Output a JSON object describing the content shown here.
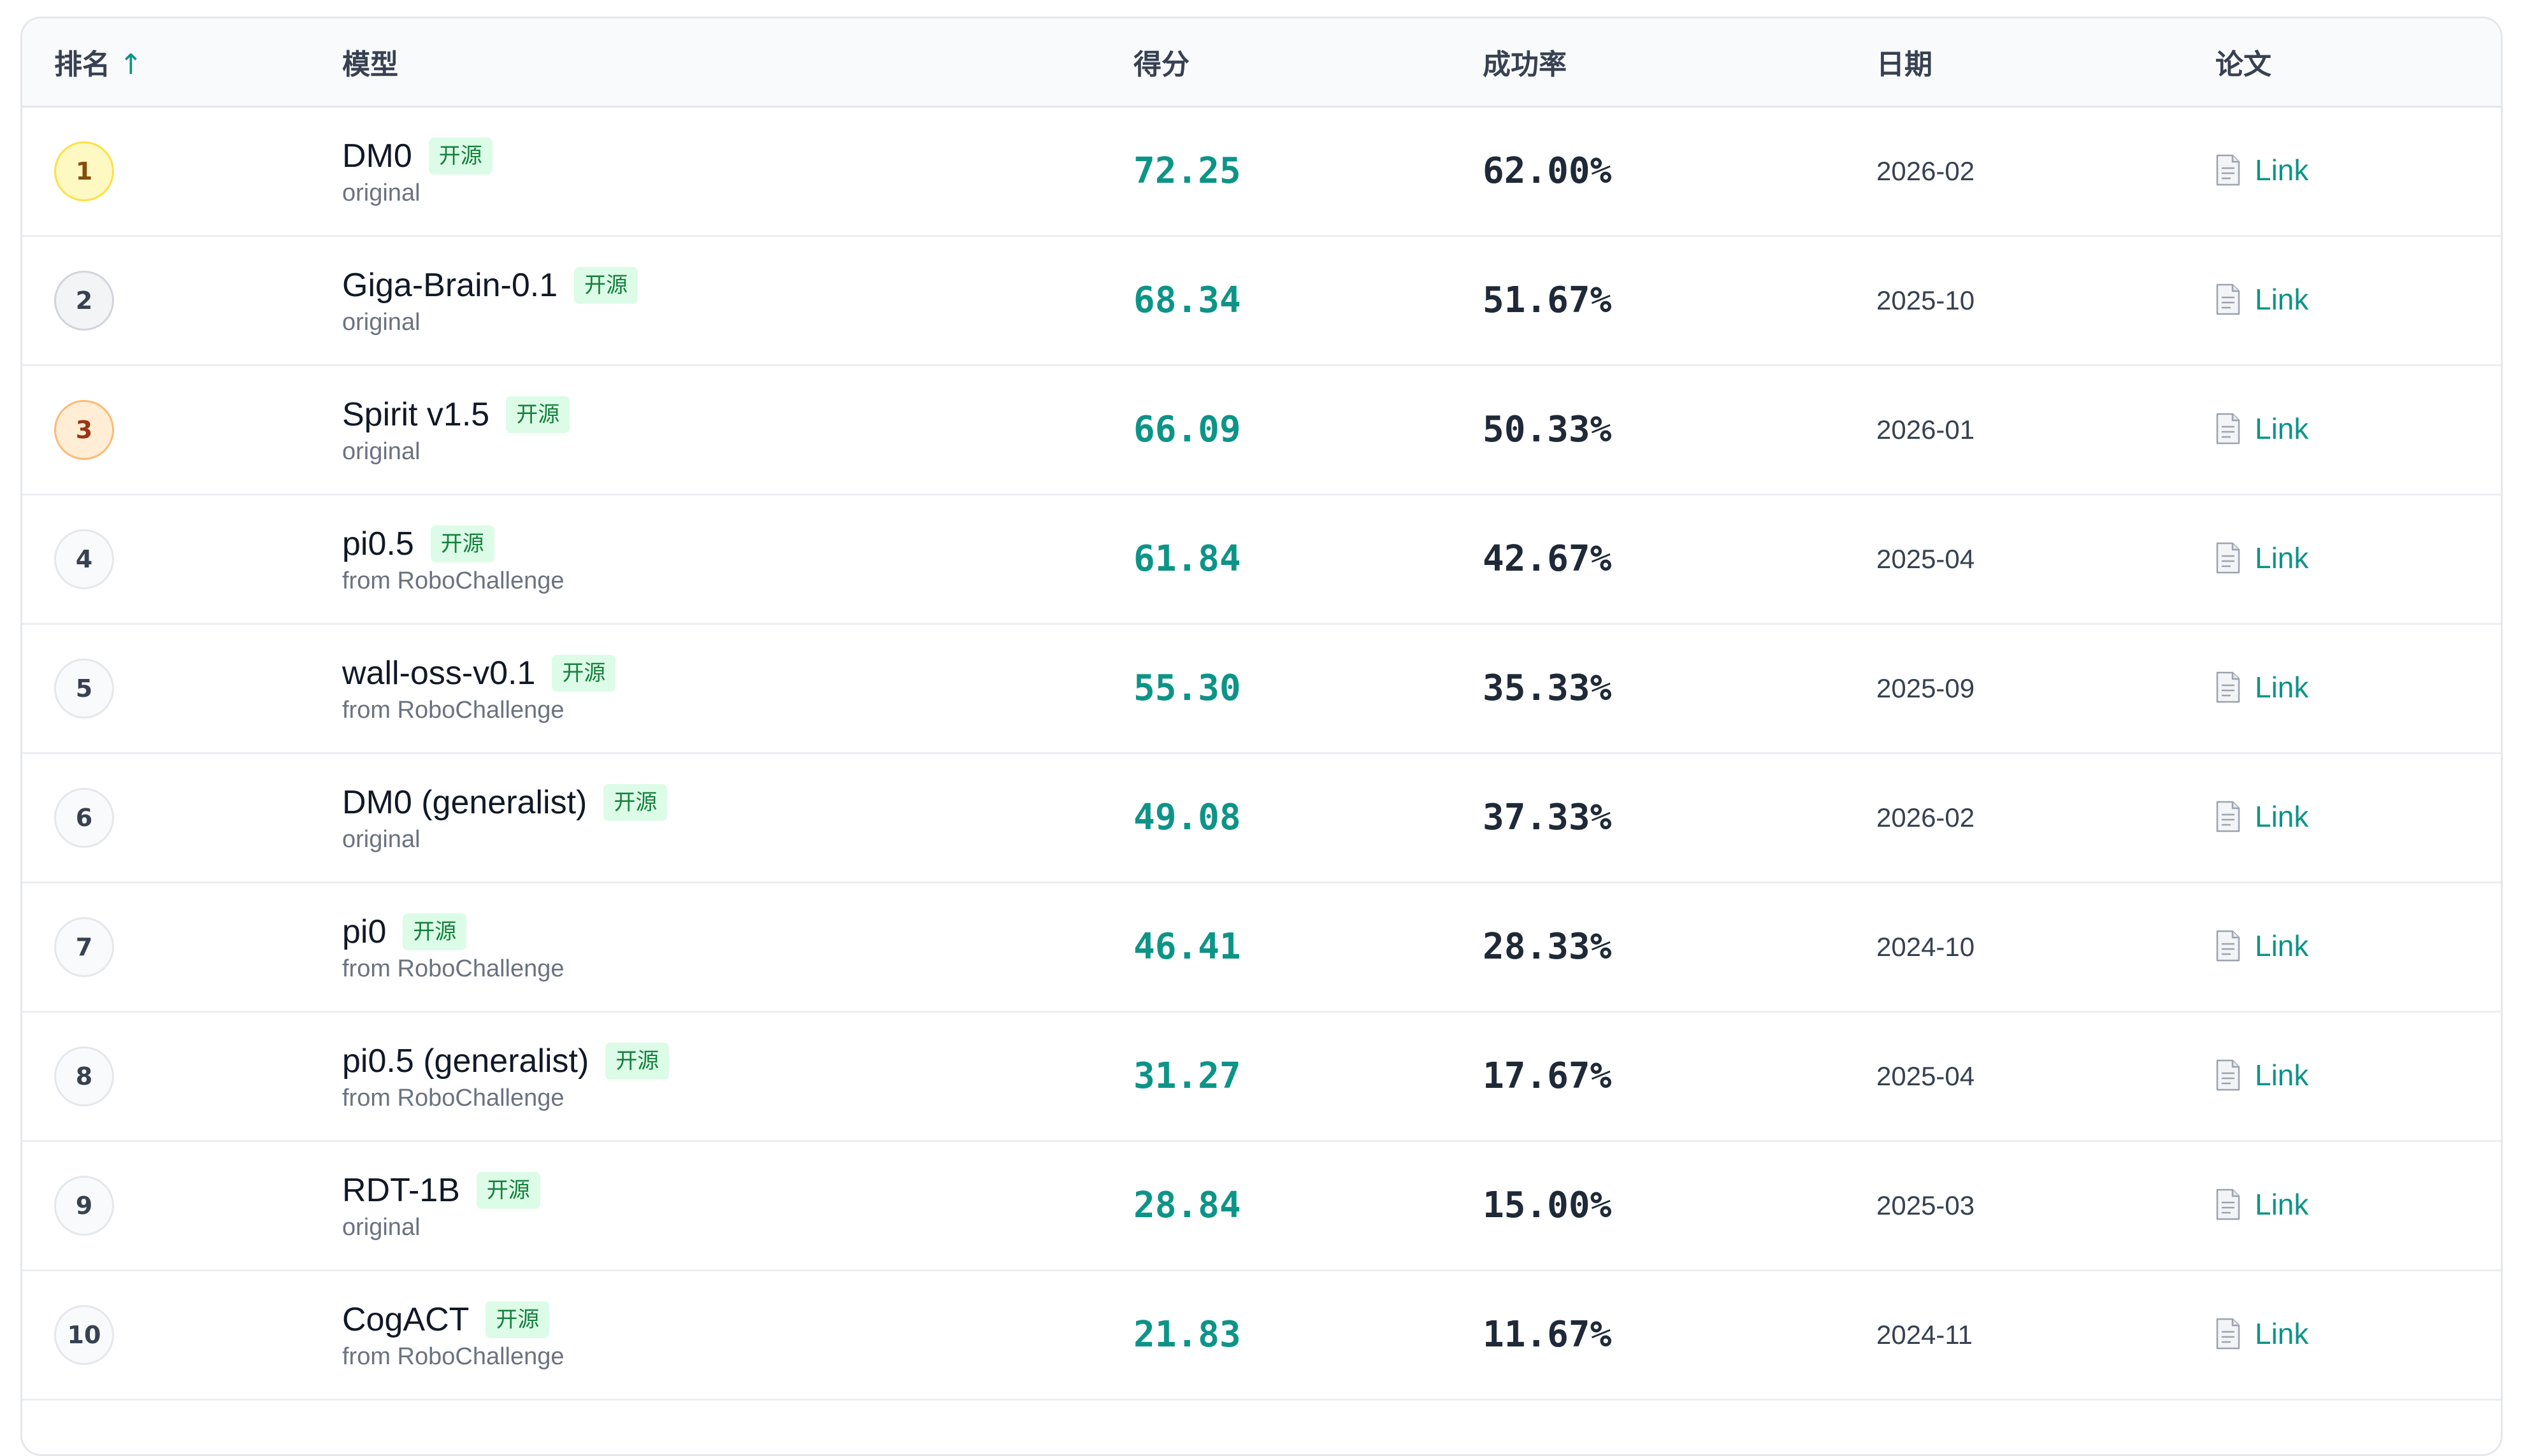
{
  "table": {
    "columns": {
      "rank": "排名",
      "rank_sort_indicator": "↑",
      "model": "模型",
      "score": "得分",
      "success_rate": "成功率",
      "date": "日期",
      "paper": "论文"
    },
    "rows": [
      {
        "rank": "1",
        "model": "DM0",
        "badge": "开源",
        "source": "original",
        "score": "72.25",
        "success_rate": "62.00%",
        "date": "2026-02",
        "paper_label": "Link"
      },
      {
        "rank": "2",
        "model": "Giga-Brain-0.1",
        "badge": "开源",
        "source": "original",
        "score": "68.34",
        "success_rate": "51.67%",
        "date": "2025-10",
        "paper_label": "Link"
      },
      {
        "rank": "3",
        "model": "Spirit v1.5",
        "badge": "开源",
        "source": "original",
        "score": "66.09",
        "success_rate": "50.33%",
        "date": "2026-01",
        "paper_label": "Link"
      },
      {
        "rank": "4",
        "model": "pi0.5",
        "badge": "开源",
        "source": "from RoboChallenge",
        "score": "61.84",
        "success_rate": "42.67%",
        "date": "2025-04",
        "paper_label": "Link"
      },
      {
        "rank": "5",
        "model": "wall-oss-v0.1",
        "badge": "开源",
        "source": "from RoboChallenge",
        "score": "55.30",
        "success_rate": "35.33%",
        "date": "2025-09",
        "paper_label": "Link"
      },
      {
        "rank": "6",
        "model": "DM0 (generalist)",
        "badge": "开源",
        "source": "original",
        "score": "49.08",
        "success_rate": "37.33%",
        "date": "2026-02",
        "paper_label": "Link"
      },
      {
        "rank": "7",
        "model": "pi0",
        "badge": "开源",
        "source": "from RoboChallenge",
        "score": "46.41",
        "success_rate": "28.33%",
        "date": "2024-10",
        "paper_label": "Link"
      },
      {
        "rank": "8",
        "model": "pi0.5 (generalist)",
        "badge": "开源",
        "source": "from RoboChallenge",
        "score": "31.27",
        "success_rate": "17.67%",
        "date": "2025-04",
        "paper_label": "Link"
      },
      {
        "rank": "9",
        "model": "RDT-1B",
        "badge": "开源",
        "source": "original",
        "score": "28.84",
        "success_rate": "15.00%",
        "date": "2025-03",
        "paper_label": "Link"
      },
      {
        "rank": "10",
        "model": "CogACT",
        "badge": "开源",
        "source": "from RoboChallenge",
        "score": "21.83",
        "success_rate": "11.67%",
        "date": "2024-11",
        "paper_label": "Link"
      }
    ]
  },
  "colors": {
    "accent": "#0d9488",
    "badge_bg": "#dcfce7",
    "badge_text": "#15803d",
    "rank_gold": "#fef9c3",
    "rank_silver": "#f3f4f6",
    "rank_bronze": "#ffedd5"
  },
  "icons": {
    "paper": "document-icon"
  }
}
